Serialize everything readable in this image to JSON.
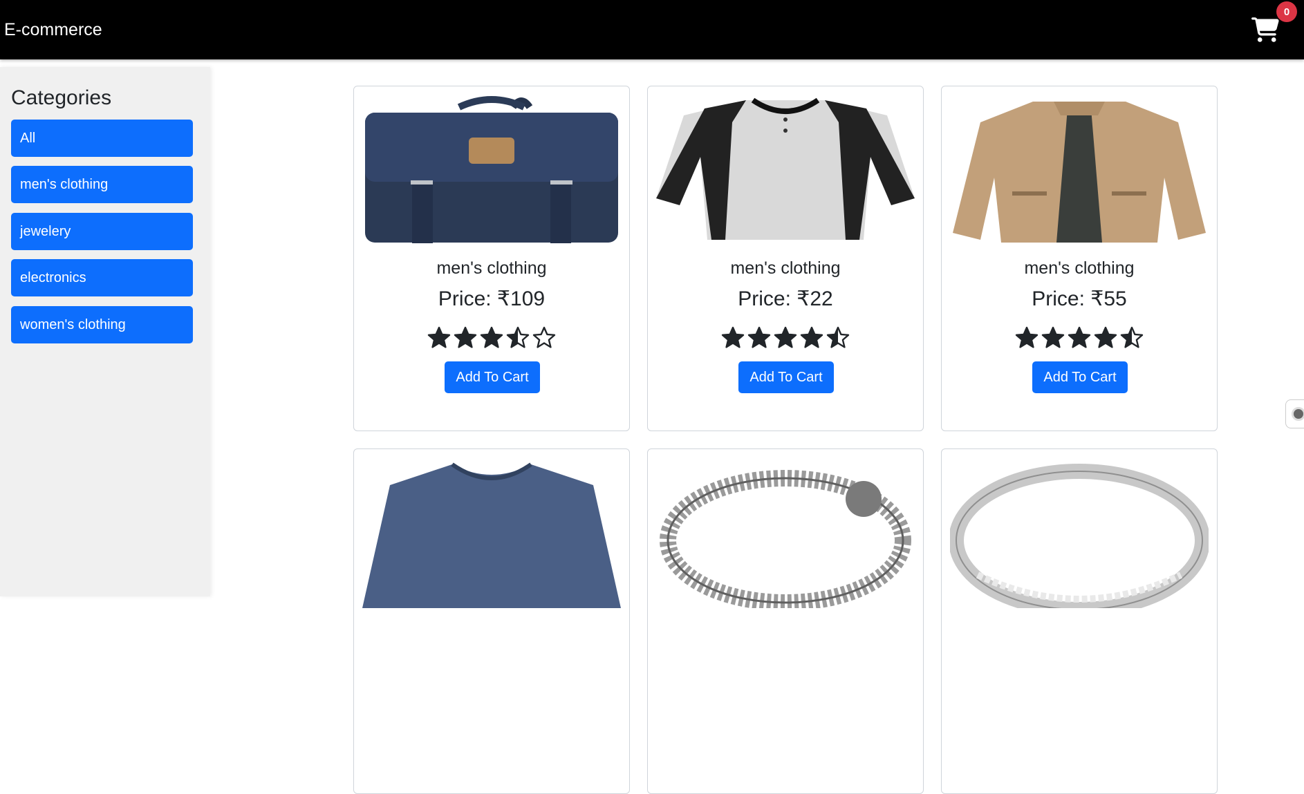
{
  "navbar": {
    "brand": "E-commerce",
    "cart_icon": "cart-icon",
    "cart_count": "0"
  },
  "sidebar": {
    "title": "Categories",
    "items": [
      {
        "label": "All"
      },
      {
        "label": "men's clothing"
      },
      {
        "label": "jewelery"
      },
      {
        "label": "electronics"
      },
      {
        "label": "women's clothing"
      }
    ]
  },
  "products": [
    {
      "category": "men's clothing",
      "price": "Price: ₹109",
      "rating": 3.5,
      "image": "backpack-image",
      "button": "Add To Cart"
    },
    {
      "category": "men's clothing",
      "price": "Price: ₹22",
      "rating": 4.5,
      "image": "raglan-tshirt-image",
      "button": "Add To Cart"
    },
    {
      "category": "men's clothing",
      "price": "Price: ₹55",
      "rating": 4.5,
      "image": "jacket-image",
      "button": "Add To Cart"
    },
    {
      "image": "longsleeve-shirt-image"
    },
    {
      "image": "dragon-bracelet-image"
    },
    {
      "image": "diamond-ring-image"
    }
  ],
  "colors": {
    "primary": "#0d6efd",
    "navbar": "#000000",
    "badge": "#dc3545",
    "sidebar": "#f0f0f0"
  }
}
